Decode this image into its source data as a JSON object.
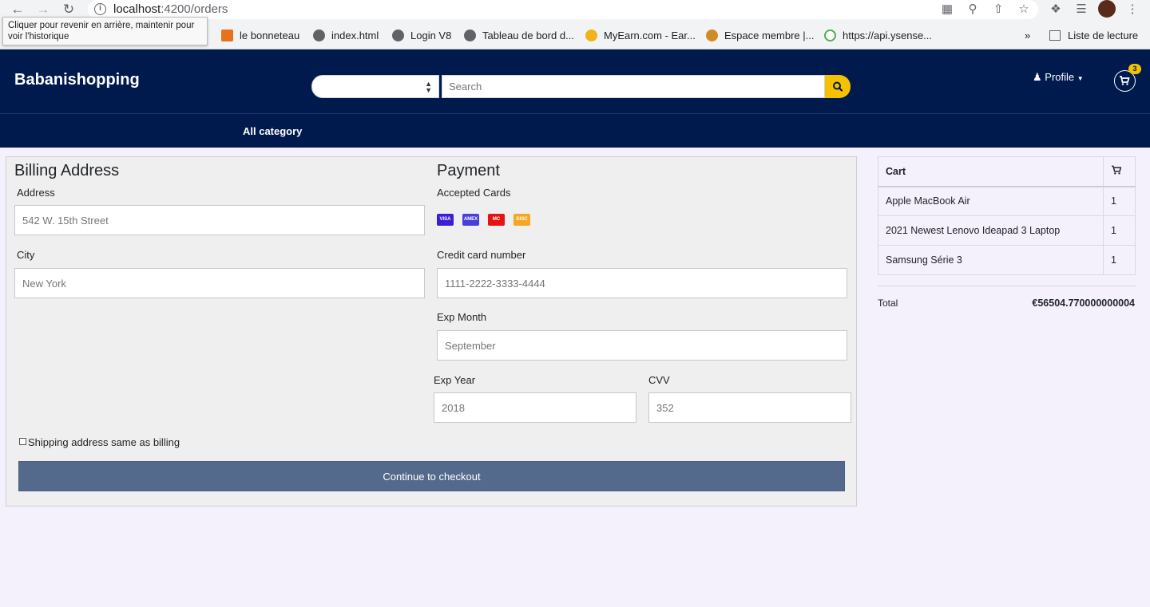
{
  "browser": {
    "url_host": "localhost",
    "url_path": ":4200/orders",
    "tooltip": "Cliquer pour revenir en arrière, maintenir pour voir l'historique",
    "bookmarks": [
      {
        "label": "le bonneteau"
      },
      {
        "label": "index.html"
      },
      {
        "label": "Login V8"
      },
      {
        "label": "Tableau de bord d..."
      },
      {
        "label": "MyEarn.com - Ear..."
      },
      {
        "label": "Espace membre |..."
      },
      {
        "label": "https://api.ysense..."
      }
    ],
    "overflow": "»",
    "reading_list": "Liste de lecture"
  },
  "header": {
    "brand": "Babanishopping",
    "search_placeholder": "Search",
    "profile_label": "Profile",
    "cart_count": "3",
    "all_category": "All category"
  },
  "billing": {
    "title": "Billing Address",
    "address_label": "Address",
    "address_placeholder": "542 W. 15th Street",
    "city_label": "City",
    "city_placeholder": "New York"
  },
  "payment": {
    "title": "Payment",
    "accepted_cards_label": "Accepted Cards",
    "cards": [
      "VISA",
      "AMEX",
      "MC",
      "DISC"
    ],
    "card_number_label": "Credit card number",
    "card_number_placeholder": "1111-2222-3333-4444",
    "exp_month_label": "Exp Month",
    "exp_month_placeholder": "September",
    "exp_year_label": "Exp Year",
    "exp_year_placeholder": "2018",
    "cvv_label": "CVV",
    "cvv_placeholder": "352"
  },
  "shipping_same_label": "Shipping address same as billing",
  "checkout_button": "Continue to checkout",
  "cart": {
    "header": "Cart",
    "items": [
      {
        "name": "Apple MacBook Air",
        "qty": "1"
      },
      {
        "name": "2021 Newest Lenovo Ideapad 3 Laptop",
        "qty": "1"
      },
      {
        "name": "Samsung Série 3",
        "qty": "1"
      }
    ],
    "total_label": "Total",
    "total_value": "€56504.770000000004"
  },
  "colors": {
    "navy": "#001a4d",
    "accent_yellow": "#f6c200",
    "button": "#546a8c",
    "page_bg": "#f4f0fc"
  }
}
